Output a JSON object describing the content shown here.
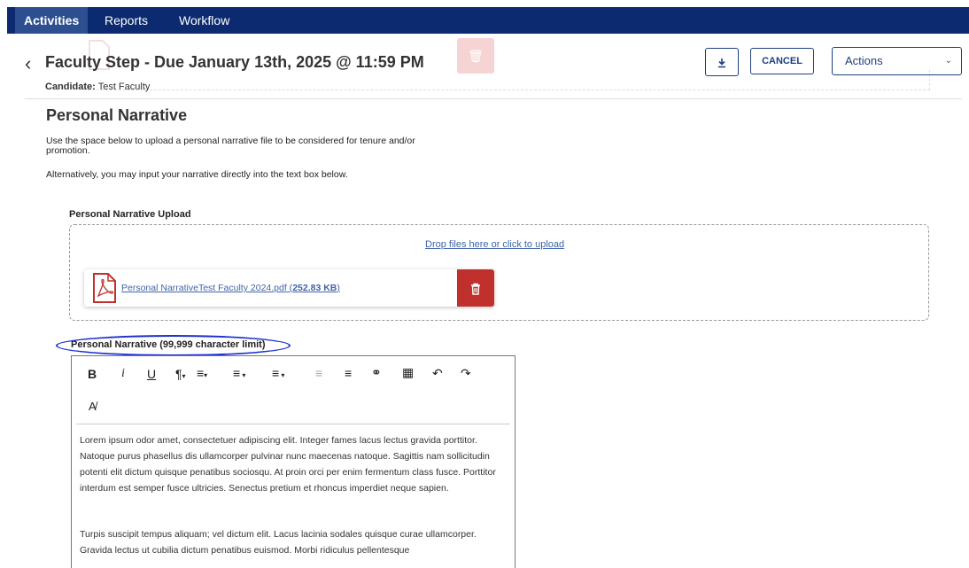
{
  "nav": {
    "tabs": [
      {
        "label": "Activities",
        "active": true
      },
      {
        "label": "Reports",
        "active": false
      },
      {
        "label": "Workflow",
        "active": false
      }
    ]
  },
  "header": {
    "title": "Faculty Step - Due January 13th, 2025 @ 11:59 PM",
    "candidate_label": "Candidate:",
    "candidate_value": "Test Faculty",
    "cancel_label": "CANCEL",
    "actions_label": "Actions"
  },
  "section": {
    "title": "Personal Narrative",
    "para1": "Use the space below to upload a personal narrative file to be considered for tenure and/or promotion.",
    "para2": "Alternatively, you may input your narrative directly into the text box below."
  },
  "upload": {
    "label": "Personal Narrative Upload",
    "drop_text": "Drop files here or click to upload",
    "file_name": "Personal NarrativeTest Faculty 2024.pdf",
    "file_size": "252.83 KB"
  },
  "narrative": {
    "label": "Personal Narrative (99,999 character limit)",
    "toolbar": [
      "bold-icon",
      "italic-icon",
      "underline-icon",
      "paragraph-icon",
      "align-icon",
      "numbered-list-icon",
      "bullet-list-icon",
      "outdent-icon",
      "indent-icon",
      "link-icon",
      "table-icon",
      "undo-icon",
      "redo-icon",
      "clear-format-icon"
    ],
    "body_p1": "Lorem ipsum odor amet, consectetuer adipiscing elit. Integer fames lacus lectus gravida porttitor. Natoque purus phasellus dis ullamcorper pulvinar nunc maecenas natoque. Sagittis nam sollicitudin potenti elit dictum quisque penatibus sociosqu. At proin orci per enim fermentum class fusce. Porttitor interdum est semper fusce ultricies. Senectus pretium et rhoncus imperdiet neque sapien.",
    "body_p2": "Turpis suscipit tempus aliquam; vel dictum elit. Lacus lacinia sodales quisque curae ullamcorper. Gravida lectus ut cubilia dictum penatibus euismod. Morbi ridiculus pellentesque"
  },
  "colors": {
    "nav_bg": "#0b2a6f",
    "accent": "#1e3f7e",
    "delete": "#c0302c",
    "link": "#3f64a8",
    "annotation_oval": "#1a2fd0"
  }
}
